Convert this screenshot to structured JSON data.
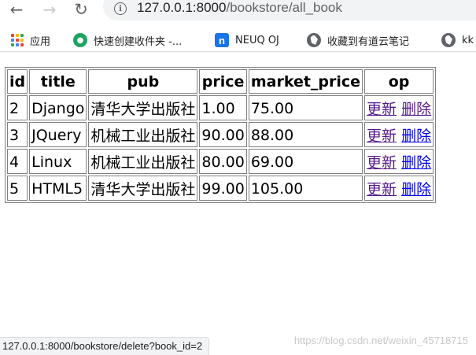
{
  "browser": {
    "url_host": "127.0.0.1:8000",
    "url_path": "/bookstore/all_book",
    "back_icon": "arrow-left-icon",
    "forward_icon": "arrow-right-icon",
    "reload_icon": "reload-icon",
    "site_info_icon": "info-icon"
  },
  "bookmarks": [
    {
      "label": "应用",
      "icon": "apps-grid-icon"
    },
    {
      "label": "快速创建收件夹 -...",
      "icon": "green-circle-icon",
      "color": "#1da462"
    },
    {
      "label": "NEUQ OJ",
      "icon": "n-logo-icon",
      "color": "#1a73e8"
    },
    {
      "label": "收藏到有道云笔记",
      "icon": "globe-icon"
    },
    {
      "label": "kk",
      "icon": "globe-icon"
    }
  ],
  "table": {
    "headers": [
      "id",
      "title",
      "pub",
      "price",
      "market_price",
      "op"
    ],
    "rows": [
      {
        "id": "2",
        "title": "Django",
        "pub": "清华大学出版社",
        "price": "1.00",
        "market_price": "75.00",
        "update": "更新",
        "delete": "删除"
      },
      {
        "id": "3",
        "title": "JQuery",
        "pub": "机械工业出版社",
        "price": "90.00",
        "market_price": "88.00",
        "update": "更新",
        "delete": "删除"
      },
      {
        "id": "4",
        "title": "Linux",
        "pub": "机械工业出版社",
        "price": "80.00",
        "market_price": "69.00",
        "update": "更新",
        "delete": "删除"
      },
      {
        "id": "5",
        "title": "HTML5",
        "pub": "清华大学出版社",
        "price": "99.00",
        "market_price": "105.00",
        "update": "更新",
        "delete": "删除"
      }
    ]
  },
  "status_bar": {
    "text": "127.0.0.1:8000/bookstore/delete?book_id=2"
  },
  "watermark": "https://blog.csdn.net/weixin_45718715",
  "colors": {
    "visited_link": "#551a8b",
    "link": "#0000ee",
    "table_border": "#808080"
  }
}
